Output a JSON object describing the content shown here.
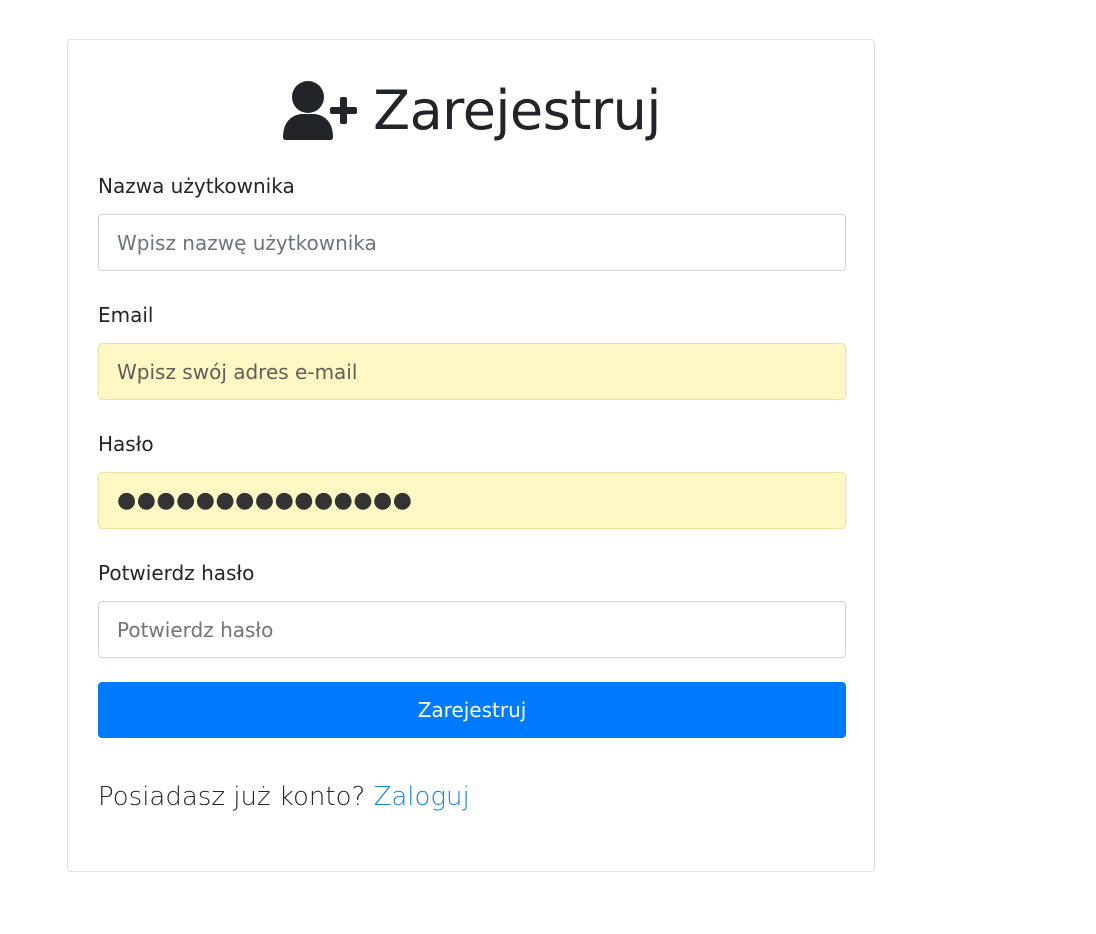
{
  "header": {
    "icon": "user-plus-icon",
    "title": "Zarejestruj"
  },
  "form": {
    "username": {
      "label": "Nazwa użytkownika",
      "placeholder": "Wpisz nazwę użytkownika",
      "value": ""
    },
    "email": {
      "label": "Email",
      "placeholder": "Wpisz swój adres e-mail",
      "value": ""
    },
    "password": {
      "label": "Hasło",
      "value_masked": "●●●●●●●●●●●●●●●"
    },
    "confirm_password": {
      "label": "Potwierdz hasło",
      "placeholder": "Potwierdz hasło",
      "value": ""
    },
    "submit_label": "Zarejestruj"
  },
  "footer": {
    "question": "Posiadasz już konto?",
    "login_link": "Zaloguj"
  },
  "colors": {
    "primary": "#007bff",
    "autofill_background": "#fff7c4",
    "link": "#1a7fe6"
  }
}
